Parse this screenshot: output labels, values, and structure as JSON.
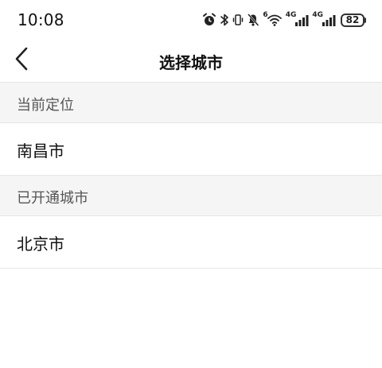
{
  "status_bar": {
    "time": "10:08",
    "icons": [
      "alarm-icon",
      "bluetooth-icon",
      "vibrate-icon",
      "mute-icon",
      "wifi-icon",
      "signal-icon",
      "signal-icon"
    ],
    "wifi_label": "6",
    "network_1": "4G",
    "network_2": "4G",
    "battery": "82"
  },
  "nav": {
    "back_icon": "chevron-left-icon",
    "title": "选择城市"
  },
  "sections": [
    {
      "header": "当前定位",
      "items": [
        "南昌市"
      ]
    },
    {
      "header": "已开通城市",
      "items": [
        "北京市"
      ]
    }
  ],
  "colors": {
    "header_bg": "#f5f5f5",
    "divider": "#e6e6e6",
    "text_primary": "#111111",
    "text_secondary": "#555555"
  }
}
